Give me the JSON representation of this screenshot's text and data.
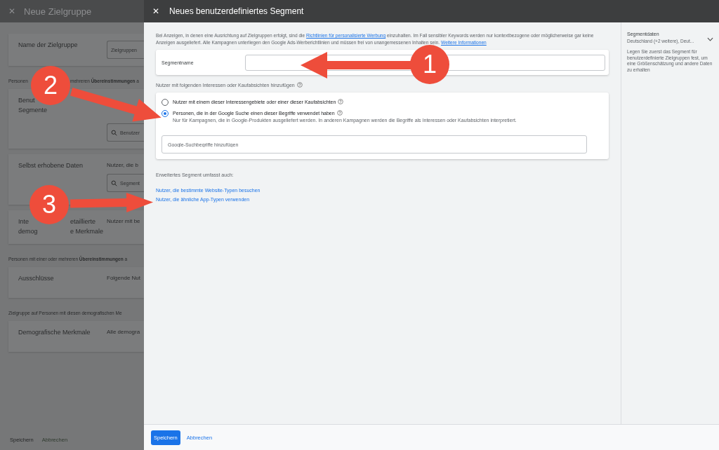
{
  "background_dialog": {
    "close": "✕",
    "title": "Neue Zielgruppe",
    "rows": [
      {
        "kind": "field",
        "label_lines": [
          [
            "Name der Zielgruppe"
          ]
        ],
        "value": "Zielgruppen"
      },
      {
        "kind": "note",
        "parts": [
          "Personen",
          "mehreren **Übereinstimmungen** a"
        ]
      },
      {
        "kind": "search",
        "label_lines": [
          [
            "Benut"
          ],
          [
            "Segmente"
          ]
        ],
        "placeholder": "Benutzer"
      },
      {
        "kind": "search",
        "label_lines": [
          [
            "Selbst erhobene Daten"
          ]
        ],
        "value": "Nutzer, die b",
        "placeholder": "Segment"
      },
      {
        "kind": "text",
        "label_lines": [
          [
            "Inte",
            "etaillierte"
          ],
          [
            "demog",
            "e Merkmale"
          ]
        ],
        "value": "Nutzer mit be"
      },
      {
        "kind": "note",
        "parts": [
          "Personen mit einer oder mehreren **Übereinstimmungen** a"
        ]
      },
      {
        "kind": "text",
        "label_lines": [
          [
            "Ausschlüsse"
          ]
        ],
        "value": "Folgende Nut"
      },
      {
        "kind": "note",
        "parts": [
          "Zielgruppe auf Personen mit diesen demografischen Me"
        ]
      },
      {
        "kind": "text",
        "label_lines": [
          [
            "Demografische Merkmale"
          ]
        ],
        "value": "Alle demogra"
      }
    ],
    "buttons": [
      "Speichern",
      "Abbrechen"
    ]
  },
  "dialog": {
    "close": "✕",
    "title": "Neues benutzerdefiniertes Segment",
    "info": [
      {
        "text": "Bei Anzeigen, in denen eine Ausrichtung auf Zielgruppen erfolgt, sind die ",
        "kind": "text"
      },
      {
        "text": "Richtlinien für personalisierte Werbung",
        "kind": "link"
      },
      {
        "text": " einzuhalten. Im Fall sensibler Keywords werden nur kontextbezogene oder möglicherweise gar keine Anzeigen ausgeliefert. Alle Kampagnen unterliegen den Google Ads-Werberichtlinien und müssen frei von unangemessenen Inhalten sein. ",
        "kind": "text"
      },
      {
        "text": "Weitere Informationen",
        "kind": "link"
      }
    ],
    "segment_name": {
      "label": "Segmentname"
    },
    "section_label": "Nutzer mit folgenden Interessen oder Kaufabsichten hinzufügen",
    "options": [
      {
        "label": "Nutzer mit einem dieser Interessengebiete oder einer dieser Kaufabsichten",
        "selected": false
      },
      {
        "label": "Personen, die in der Google Suche einen dieser Begriffe verwendet haben",
        "note": "Nur für Kampagnen, die in Google-Produkten ausgeliefert werden. In anderen Kampagnen werden die Begriffe als Interessen oder Kaufabsichten interpretiert.",
        "selected": true
      }
    ],
    "search_terms": {
      "placeholder": "Google-Suchbegriffe hinzufügen"
    },
    "extended_label": "Erweitertes Segment umfasst auch:",
    "links": [
      "Nutzer, die bestimmte Website-Typen besuchen",
      "Nutzer, die ähnliche App-Typen verwenden"
    ],
    "buttons": [
      {
        "label": "Speichern",
        "kind": "primary"
      },
      {
        "label": "Abbrechen",
        "kind": "text"
      }
    ]
  },
  "side_panel": {
    "title": "Segmentdaten",
    "summary": "Deutschland (+2 weitere), Deut...",
    "description": "Legen Sie zuerst das Segment für benutzerdefinierte Zielgruppen fest, um eine Größenschätzung und andere Daten zu erhalten"
  },
  "callouts": [
    {
      "number": "1"
    },
    {
      "number": "2"
    },
    {
      "number": "3"
    }
  ]
}
